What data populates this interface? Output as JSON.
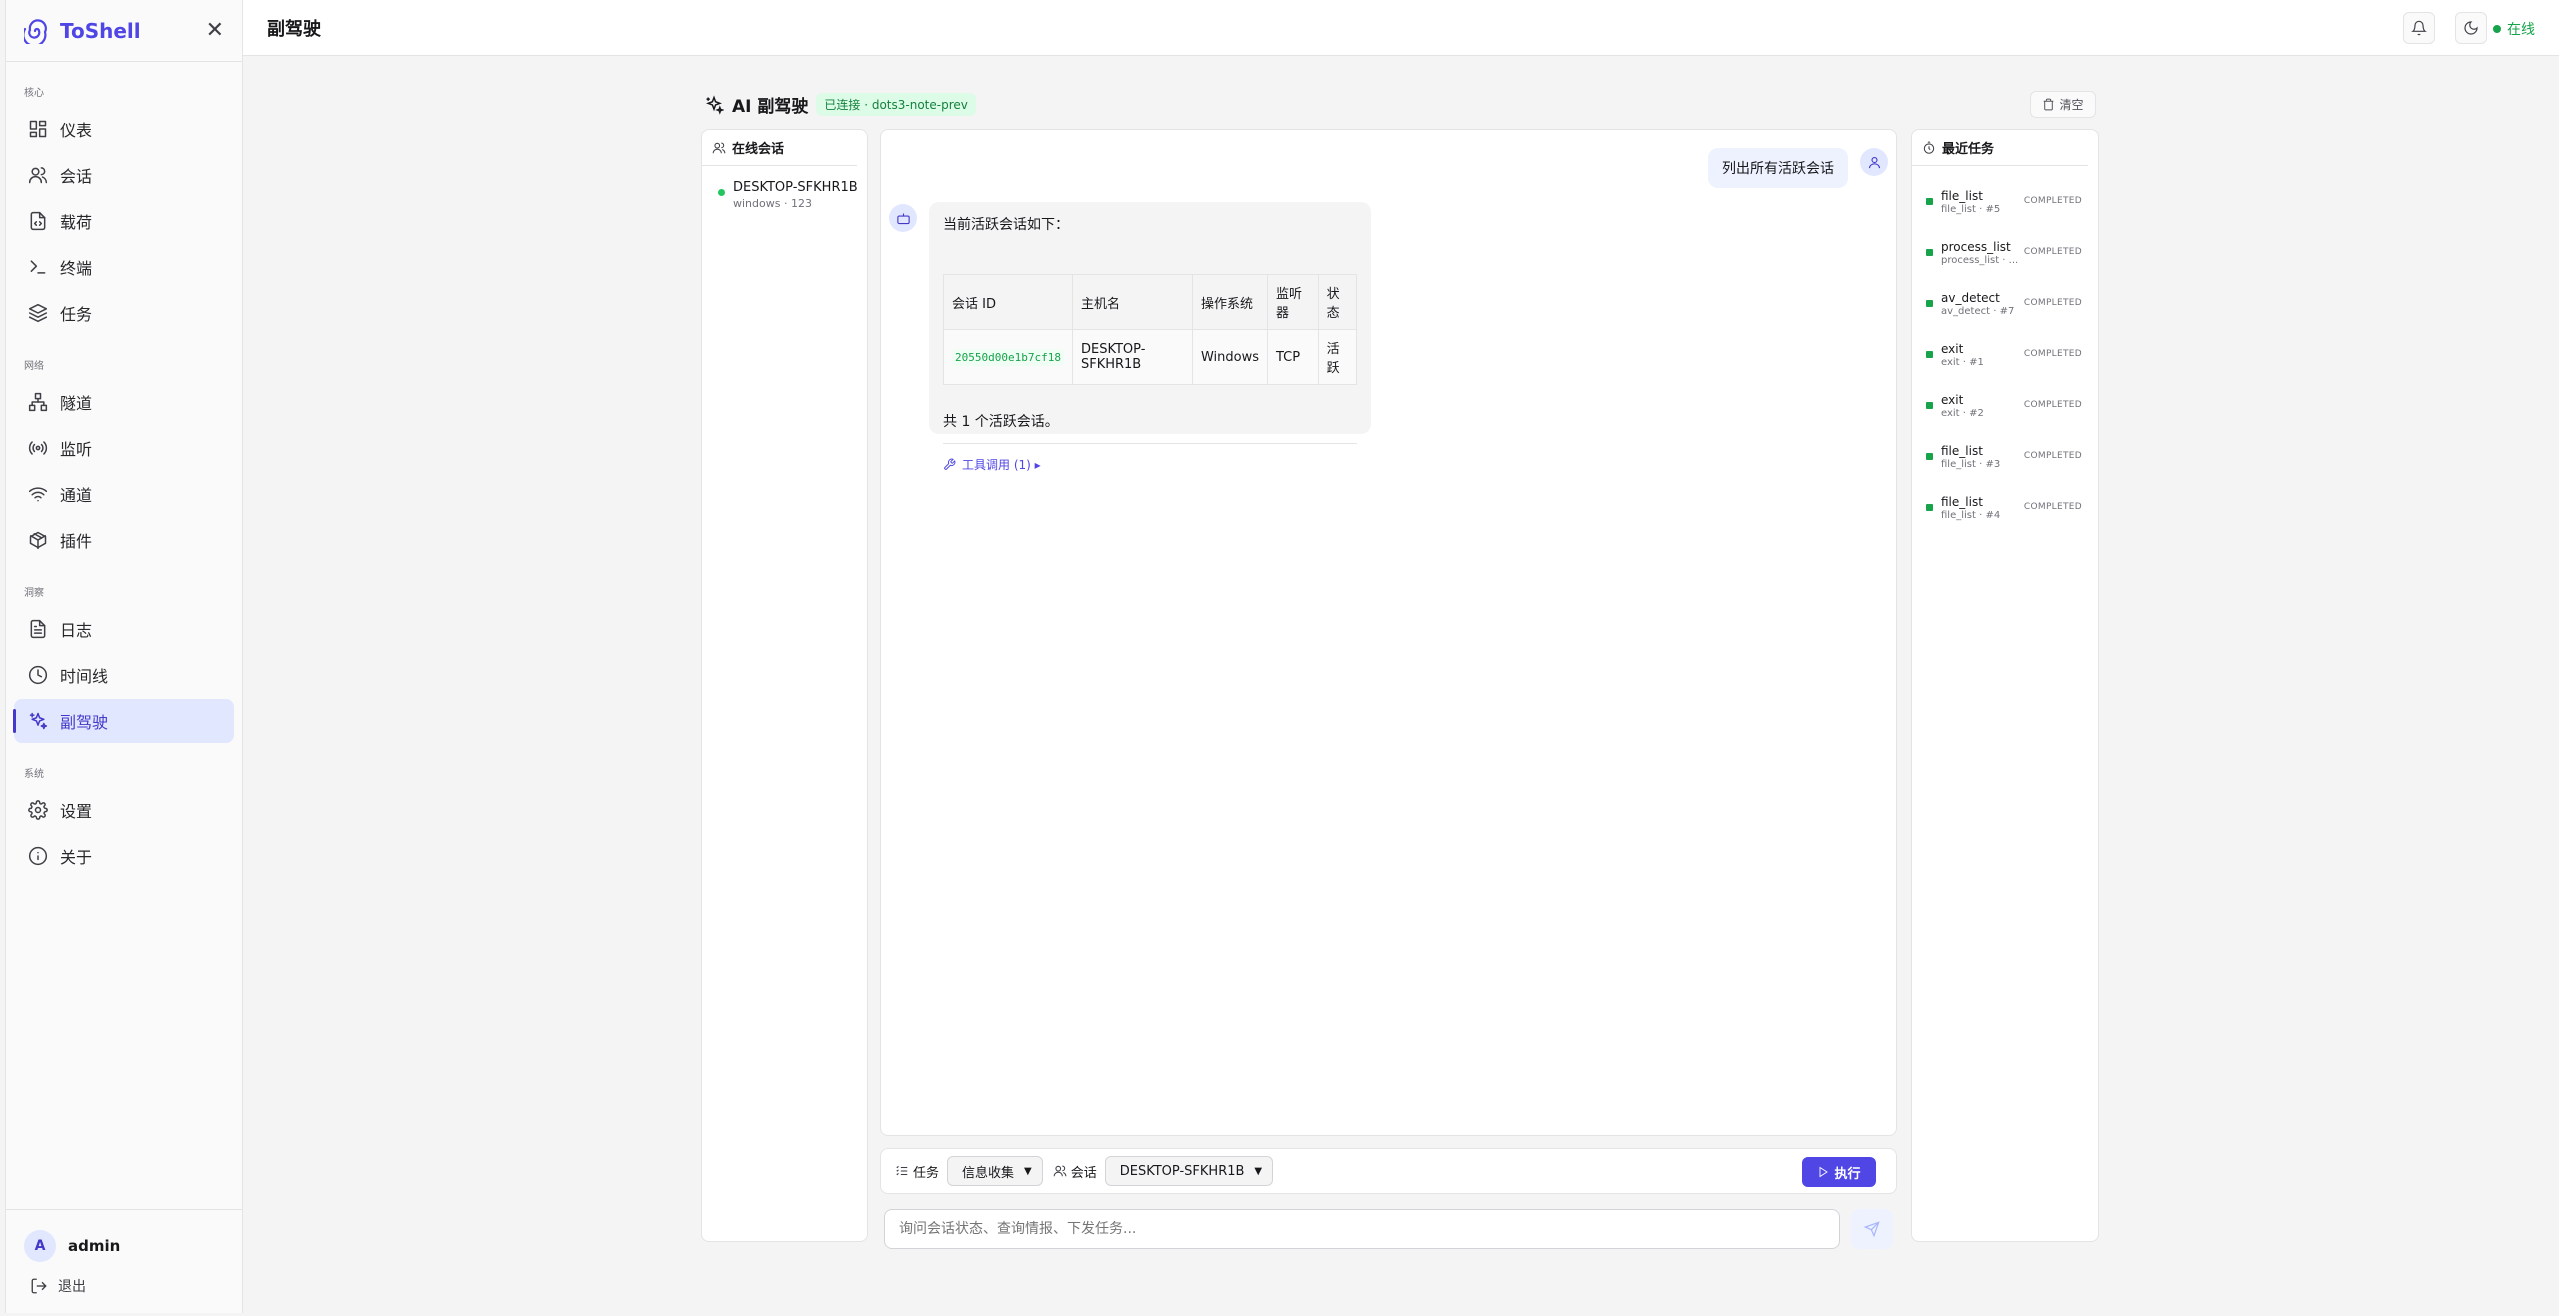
{
  "app": {
    "name": "ToShell"
  },
  "sidebar": {
    "groups": [
      {
        "label": "核心",
        "items": [
          "仪表",
          "会话",
          "载荷",
          "终端",
          "任务"
        ]
      },
      {
        "label": "网络",
        "items": [
          "隧道",
          "监听",
          "通道",
          "插件"
        ]
      },
      {
        "label": "洞察",
        "items": [
          "日志",
          "时间线",
          "副驾驶"
        ]
      },
      {
        "label": "系统",
        "items": [
          "设置",
          "关于"
        ]
      }
    ],
    "user": {
      "initial": "A",
      "name": "admin"
    },
    "logout": "退出"
  },
  "header": {
    "title": "副驾驶",
    "status": "在线"
  },
  "panel": {
    "title": "AI 副驾驶",
    "badge": "已连接 · dots3-note-prev",
    "clear": "清空"
  },
  "sessions": {
    "title": "在线会话",
    "items": [
      {
        "host": "DESKTOP-SFKHR1B",
        "sub": "windows · 123"
      }
    ]
  },
  "chat": {
    "user_message": "列出所有活跃会话",
    "bot_intro": "当前活跃会话如下：",
    "table": {
      "headers": [
        "会话 ID",
        "主机名",
        "操作系统",
        "监听器",
        "状态"
      ],
      "rows": [
        [
          "20550d00e1b7cf18",
          "DESKTOP-SFKHR1B",
          "Windows",
          "TCP",
          "活跃"
        ]
      ]
    },
    "bot_total": "共 1 个活跃会话。",
    "tool_call": "工具调用 (1) ▸"
  },
  "toolbar": {
    "task_label": "任务",
    "task_value": "信息收集",
    "session_label": "会话",
    "session_value": "DESKTOP-SFKHR1B",
    "exec": "执行"
  },
  "input": {
    "placeholder": "询问会话状态、查询情报、下发任务..."
  },
  "tasks": {
    "title": "最近任务",
    "items": [
      {
        "name": "file_list",
        "sub": "file_list · #5",
        "status": "COMPLETED"
      },
      {
        "name": "process_list",
        "sub": "process_list · ...",
        "status": "COMPLETED"
      },
      {
        "name": "av_detect",
        "sub": "av_detect · #7",
        "status": "COMPLETED"
      },
      {
        "name": "exit",
        "sub": "exit · #1",
        "status": "COMPLETED"
      },
      {
        "name": "exit",
        "sub": "exit · #2",
        "status": "COMPLETED"
      },
      {
        "name": "file_list",
        "sub": "file_list · #3",
        "status": "COMPLETED"
      },
      {
        "name": "file_list",
        "sub": "file_list · #4",
        "status": "COMPLETED"
      }
    ]
  }
}
